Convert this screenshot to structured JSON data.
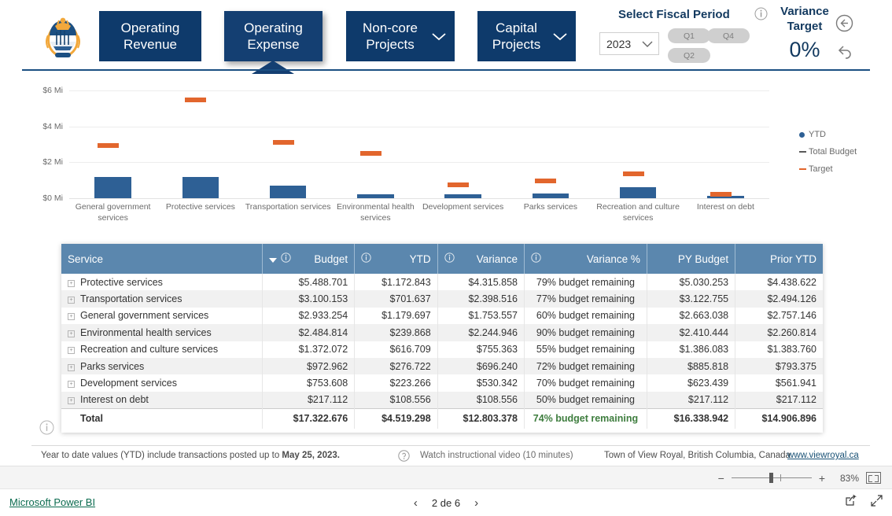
{
  "header": {
    "crest_alt": "town-crest",
    "tabs": [
      {
        "label": "Operating Revenue",
        "line1": "Operating",
        "line2": "Revenue",
        "chevron": false,
        "active": false
      },
      {
        "label": "Operating Expense",
        "line1": "Operating",
        "line2": "Expense",
        "chevron": false,
        "active": true
      },
      {
        "label": "Non-core Projects",
        "line1": "Non-core",
        "line2": "Projects",
        "chevron": true,
        "active": false
      },
      {
        "label": "Capital Projects",
        "line1": "Capital",
        "line2": "Projects",
        "chevron": true,
        "active": false
      }
    ],
    "fiscal_period_label": "Select Fiscal Period",
    "year_value": "2023",
    "quarters": [
      "Q1",
      "Q4",
      "Q2"
    ],
    "variance_target_title_line1": "Variance",
    "variance_target_title_line2": "Target",
    "variance_target_value": "0%",
    "back_icon": "back-circle-icon",
    "reset_icon": "reset-arrow-icon",
    "info_icon": "info-icon"
  },
  "chart_data": {
    "type": "bar",
    "title": "",
    "xlabel": "",
    "ylabel": "",
    "ylim": [
      0,
      7
    ],
    "grid": true,
    "legend_position": "right",
    "tick_labels": [
      "$0 Mi",
      "$2 Mi",
      "$4 Mi",
      "$6 Mi"
    ],
    "ticks": [
      0,
      2,
      4,
      6
    ],
    "categories": [
      "General government services",
      "Protective services",
      "Transportation services",
      "Environmental health services",
      "Development services",
      "Parks services",
      "Recreation and culture services",
      "Interest on debt"
    ],
    "series": [
      {
        "name": "YTD",
        "type": "bar",
        "color": "#2e6095",
        "values": [
          1.179697,
          1.172843,
          0.701637,
          0.239868,
          0.223266,
          0.276722,
          0.616709,
          0.108556
        ]
      },
      {
        "name": "Total Budget",
        "type": "marker",
        "color": "#2e6095",
        "values": [
          2.933254,
          5.488701,
          3.100153,
          2.484814,
          0.753608,
          0.972962,
          1.372072,
          0.217112
        ]
      },
      {
        "name": "Target",
        "type": "marker",
        "color": "#e2662d",
        "values": [
          2.933254,
          5.488701,
          3.100153,
          2.484814,
          0.753608,
          0.972962,
          1.372072,
          0.217112
        ]
      }
    ],
    "legend": [
      "YTD",
      "Total Budget",
      "Target"
    ]
  },
  "table": {
    "columns": [
      {
        "key": "service",
        "label": "Service",
        "align": "left",
        "info": false,
        "sort": false
      },
      {
        "key": "budget",
        "label": "Budget",
        "align": "right",
        "info": true,
        "sort": true
      },
      {
        "key": "ytd",
        "label": "YTD",
        "align": "right",
        "info": true,
        "sort": false
      },
      {
        "key": "variance",
        "label": "Variance",
        "align": "right",
        "info": true,
        "sort": false
      },
      {
        "key": "variance_pct",
        "label": "Variance %",
        "align": "right",
        "info": true,
        "sort": false
      },
      {
        "key": "py_budget",
        "label": "PY Budget",
        "align": "right",
        "info": false,
        "sort": false
      },
      {
        "key": "prior_ytd",
        "label": "Prior YTD",
        "align": "right",
        "info": false,
        "sort": false
      }
    ],
    "rows": [
      {
        "service": "Protective services",
        "budget": "$5.488.701",
        "ytd": "$1.172.843",
        "variance": "$4.315.858",
        "variance_pct": "79% budget remaining",
        "py_budget": "$5.030.253",
        "prior_ytd": "$4.438.622"
      },
      {
        "service": "Transportation services",
        "budget": "$3.100.153",
        "ytd": "$701.637",
        "variance": "$2.398.516",
        "variance_pct": "77% budget remaining",
        "py_budget": "$3.122.755",
        "prior_ytd": "$2.494.126"
      },
      {
        "service": "General government services",
        "budget": "$2.933.254",
        "ytd": "$1.179.697",
        "variance": "$1.753.557",
        "variance_pct": "60% budget remaining",
        "py_budget": "$2.663.038",
        "prior_ytd": "$2.757.146"
      },
      {
        "service": "Environmental health services",
        "budget": "$2.484.814",
        "ytd": "$239.868",
        "variance": "$2.244.946",
        "variance_pct": "90% budget remaining",
        "py_budget": "$2.410.444",
        "prior_ytd": "$2.260.814"
      },
      {
        "service": "Recreation and culture services",
        "budget": "$1.372.072",
        "ytd": "$616.709",
        "variance": "$755.363",
        "variance_pct": "55% budget remaining",
        "py_budget": "$1.386.083",
        "prior_ytd": "$1.383.760"
      },
      {
        "service": "Parks services",
        "budget": "$972.962",
        "ytd": "$276.722",
        "variance": "$696.240",
        "variance_pct": "72% budget remaining",
        "py_budget": "$885.818",
        "prior_ytd": "$793.375"
      },
      {
        "service": "Development services",
        "budget": "$753.608",
        "ytd": "$223.266",
        "variance": "$530.342",
        "variance_pct": "70% budget remaining",
        "py_budget": "$623.439",
        "prior_ytd": "$561.941"
      },
      {
        "service": "Interest on debt",
        "budget": "$217.112",
        "ytd": "$108.556",
        "variance": "$108.556",
        "variance_pct": "50% budget remaining",
        "py_budget": "$217.112",
        "prior_ytd": "$217.112"
      }
    ],
    "total": {
      "service": "Total",
      "budget": "$17.322.676",
      "ytd": "$4.519.298",
      "variance": "$12.803.378",
      "variance_pct": "74% budget remaining",
      "py_budget": "$16.338.942",
      "prior_ytd": "$14.906.896"
    }
  },
  "footer": {
    "note_prefix": "Year to date values (YTD) include transactions posted up to ",
    "note_date": "May 25, 2023.",
    "video_text": "Watch instructional video (10 minutes)",
    "town_text": "Town of View Royal, British Columbia, Canada",
    "url_text": "www.viewroyal.ca"
  },
  "statusbar": {
    "zoom_minus": "−",
    "zoom_plus": "+",
    "zoom_percent": "83%",
    "fit_icon": "fit-to-page-icon"
  },
  "bottombar": {
    "brand": "Microsoft Power BI",
    "prev_icon": "chevron-left-icon",
    "page_label": "2 de 6",
    "next_icon": "chevron-right-icon",
    "share_icon": "share-icon",
    "fullscreen_icon": "fullscreen-icon"
  },
  "colors": {
    "navy": "#0e3a6b",
    "header_rule": "#1b4f82",
    "bar_blue": "#2e6095",
    "target_orange": "#e2662d",
    "table_header": "#5b87ae",
    "green_text": "#3e7d3e"
  }
}
